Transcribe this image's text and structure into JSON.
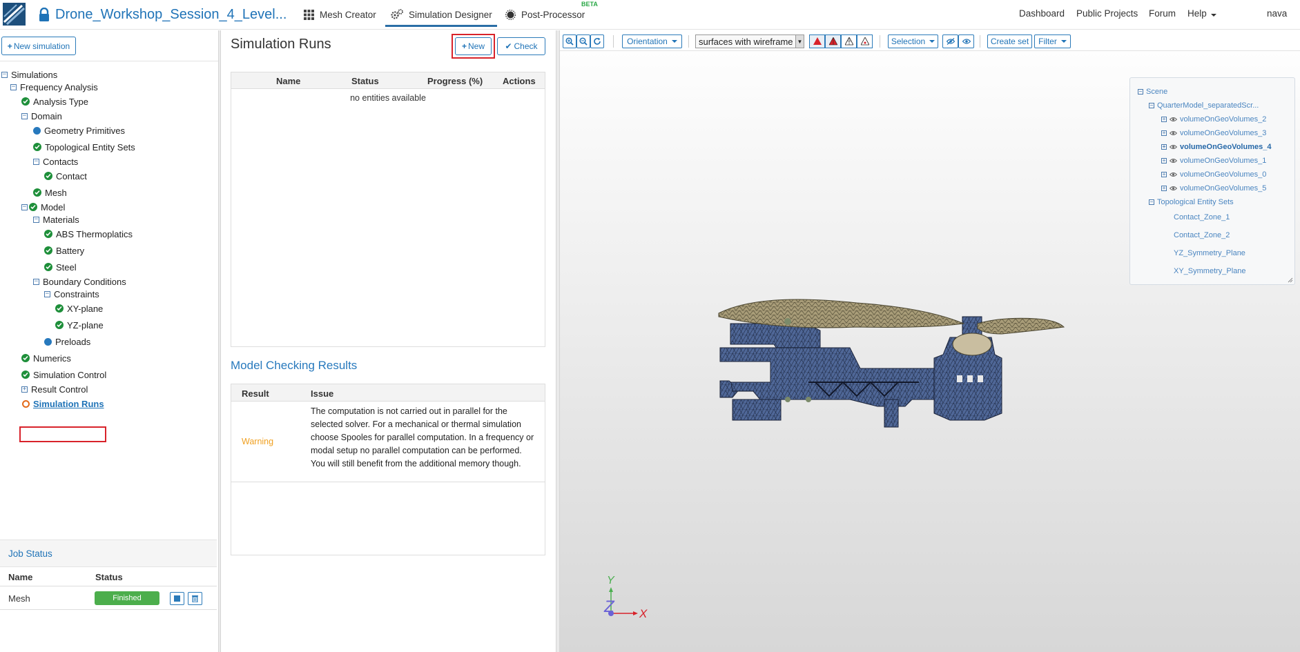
{
  "app": {
    "project_title": "Drone_Workshop_Session_4_Level...",
    "tabs": [
      {
        "label": "Mesh Creator"
      },
      {
        "label": "Simulation Designer"
      },
      {
        "label": "Post-Processor"
      }
    ],
    "beta_label": "BETA",
    "right_links": [
      "Dashboard",
      "Public Projects",
      "Forum",
      "Help",
      "nava"
    ],
    "accent_color": "#1f73b7"
  },
  "left_panel": {
    "new_simulation_label": "New simulation",
    "tree": {
      "simulations": "Simulations",
      "frequency_analysis": "Frequency Analysis",
      "analysis_type": "Analysis Type",
      "domain": "Domain",
      "geometry_primitives": "Geometry Primitives",
      "topological_entity_sets": "Topological Entity Sets",
      "contacts": "Contacts",
      "contact": "Contact",
      "mesh": "Mesh",
      "model": "Model",
      "materials": "Materials",
      "abs": "ABS Thermoplatics",
      "battery": "Battery",
      "steel": "Steel",
      "boundary_conditions": "Boundary Conditions",
      "constraints": "Constraints",
      "xy_plane": "XY-plane",
      "yz_plane": "YZ-plane",
      "preloads": "Preloads",
      "numerics": "Numerics",
      "simulation_control": "Simulation Control",
      "result_control": "Result Control",
      "simulation_runs": "Simulation Runs"
    },
    "job_status": {
      "title": "Job Status",
      "col_name": "Name",
      "col_status": "Status",
      "rows": [
        {
          "name": "Mesh",
          "status": "Finished"
        }
      ]
    }
  },
  "simulation_runs": {
    "title": "Simulation Runs",
    "new_label": "New",
    "check_label": "Check",
    "columns": [
      "Name",
      "Status",
      "Progress (%)",
      "Actions"
    ],
    "empty_text": "no entities available"
  },
  "model_checking": {
    "title": "Model Checking Results",
    "col_result": "Result",
    "col_issue": "Issue",
    "rows": [
      {
        "result": "Warning",
        "issue": "The computation is not carried out in parallel for the selected solver. For a mechanical or thermal simulation choose Spooles for parallel computation. In a frequency or modal setup no parallel computation can be performed. You will still benefit from the additional memory though."
      }
    ]
  },
  "viewer": {
    "orientation_label": "Orientation",
    "render_mode": "surfaces with wireframe",
    "selection_label": "Selection",
    "create_set_label": "Create set",
    "filter_label": "Filter",
    "scene_tree": {
      "root": "Scene",
      "model": "QuarterModel_separatedScr...",
      "volumes": [
        "volumeOnGeoVolumes_2",
        "volumeOnGeoVolumes_3",
        "volumeOnGeoVolumes_4",
        "volumeOnGeoVolumes_1",
        "volumeOnGeoVolumes_0",
        "volumeOnGeoVolumes_5"
      ],
      "topo_sets_label": "Topological Entity Sets",
      "topo_sets": [
        "Contact_Zone_1",
        "Contact_Zone_2",
        "YZ_Symmetry_Plane",
        "XY_Symmetry_Plane"
      ]
    },
    "axes": {
      "y": "Y",
      "z": "Z",
      "x": "X"
    }
  }
}
